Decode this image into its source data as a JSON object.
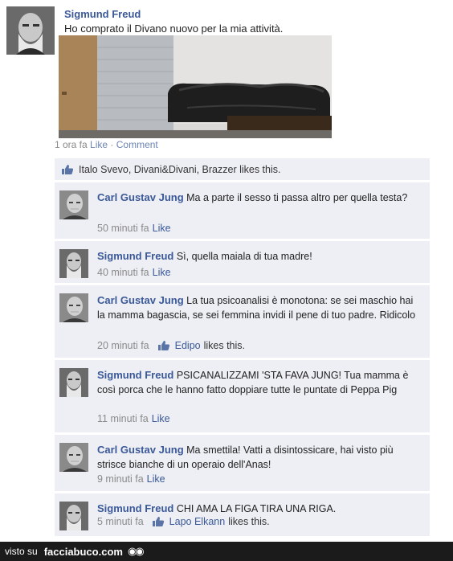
{
  "post": {
    "author": "Sigmund Freud",
    "text": "Ho comprato il Divano nuovo per la mia attività.",
    "time": "1 ora fa",
    "like_label": "Like",
    "comment_label": "Comment",
    "separator": "·"
  },
  "likes": {
    "text": "Italo Svevo, Divani&Divani, Brazzer likes this."
  },
  "comments": [
    {
      "author": "Carl Gustav Jung",
      "text": "Ma a parte il sesso ti passa altro per quella testa?",
      "time": "50 minuti fa",
      "like_label": "Like"
    },
    {
      "author": "Sigmund Freud",
      "text": "Sì, quella maiala di tua madre!",
      "time": "40 minuti fa",
      "like_label": "Like"
    },
    {
      "author": "Carl Gustav Jung",
      "text": "La tua psicoanalisi è monotona: se sei maschio hai la mamma bagascia, se sei femmina invidi il pene di tuo padre. Ridicolo",
      "time": "20 minuti fa",
      "liker": "Edipo",
      "likes_suffix": "likes this."
    },
    {
      "author": "Sigmund Freud",
      "text": "PSICANALIZZAMI 'STA FAVA JUNG! Tua mamma è così porca che le hanno fatto doppiare tutte le puntate di Peppa Pig",
      "time": "11 minuti fa",
      "like_label": "Like"
    },
    {
      "author": "Carl Gustav Jung",
      "text": "Ma smettila! Vatti a disintossicare, hai visto più strisce bianche di un operaio dell'Anas!",
      "time": "9 minuti fa",
      "like_label": "Like"
    },
    {
      "author": "Sigmund Freud",
      "text": "CHI AMA LA FIGA TIRA UNA RIGA.",
      "time": "5 minuti fa",
      "liker": "Lapo Elkann",
      "likes_suffix": "likes this."
    }
  ],
  "footer": {
    "prefix": "visto su",
    "brand": "facciabuco.com"
  },
  "colors": {
    "link": "#3b5998",
    "comment_bg": "#edeff4",
    "footer_bg": "#1b1b1b"
  }
}
